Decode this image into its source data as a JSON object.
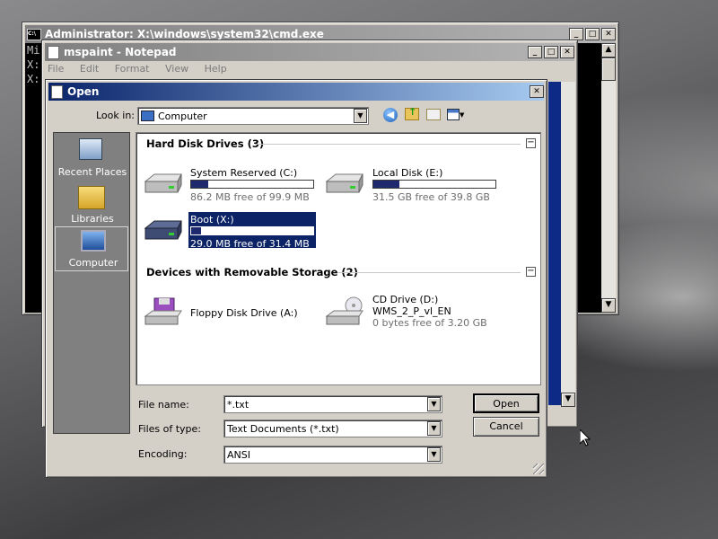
{
  "cmd_window": {
    "title": "Administrator: X:\\windows\\system32\\cmd.exe",
    "text_lines": [
      "Mi",
      "",
      "X:",
      "",
      "X:"
    ]
  },
  "notepad_window": {
    "title": "mspaint - Notepad",
    "menu": [
      "File",
      "Edit",
      "Format",
      "View",
      "Help"
    ]
  },
  "open_dialog": {
    "title": "Open",
    "look_in_label": "Look in:",
    "look_in_value": "Computer",
    "nav": [
      {
        "label": "Recent Places"
      },
      {
        "label": "Libraries"
      },
      {
        "label": "Computer"
      }
    ],
    "groups": [
      {
        "title": "Hard Disk Drives (3)",
        "items": [
          {
            "name": "System Reserved (C:)",
            "free": "86.2 MB free of 99.9 MB",
            "used_fraction": 0.14
          },
          {
            "name": "Local Disk (E:)",
            "free": "31.5 GB free of 39.8 GB",
            "used_fraction": 0.21
          },
          {
            "name": "Boot (X:)",
            "free": "29.0 MB free of 31.4 MB",
            "used_fraction": 0.08
          }
        ]
      },
      {
        "title": "Devices with Removable Storage (2)",
        "items": [
          {
            "name": "Floppy Disk Drive (A:)"
          },
          {
            "name": "CD Drive (D:)",
            "label2": "WMS_2_P_vl_EN",
            "free": "0 bytes free of 3.20 GB"
          }
        ]
      }
    ],
    "file_name_label": "File name:",
    "file_name_value": "*.txt",
    "file_type_label": "Files of type:",
    "file_type_value": "Text Documents (*.txt)",
    "encoding_label": "Encoding:",
    "encoding_value": "ANSI",
    "open_button": "Open",
    "cancel_button": "Cancel"
  }
}
